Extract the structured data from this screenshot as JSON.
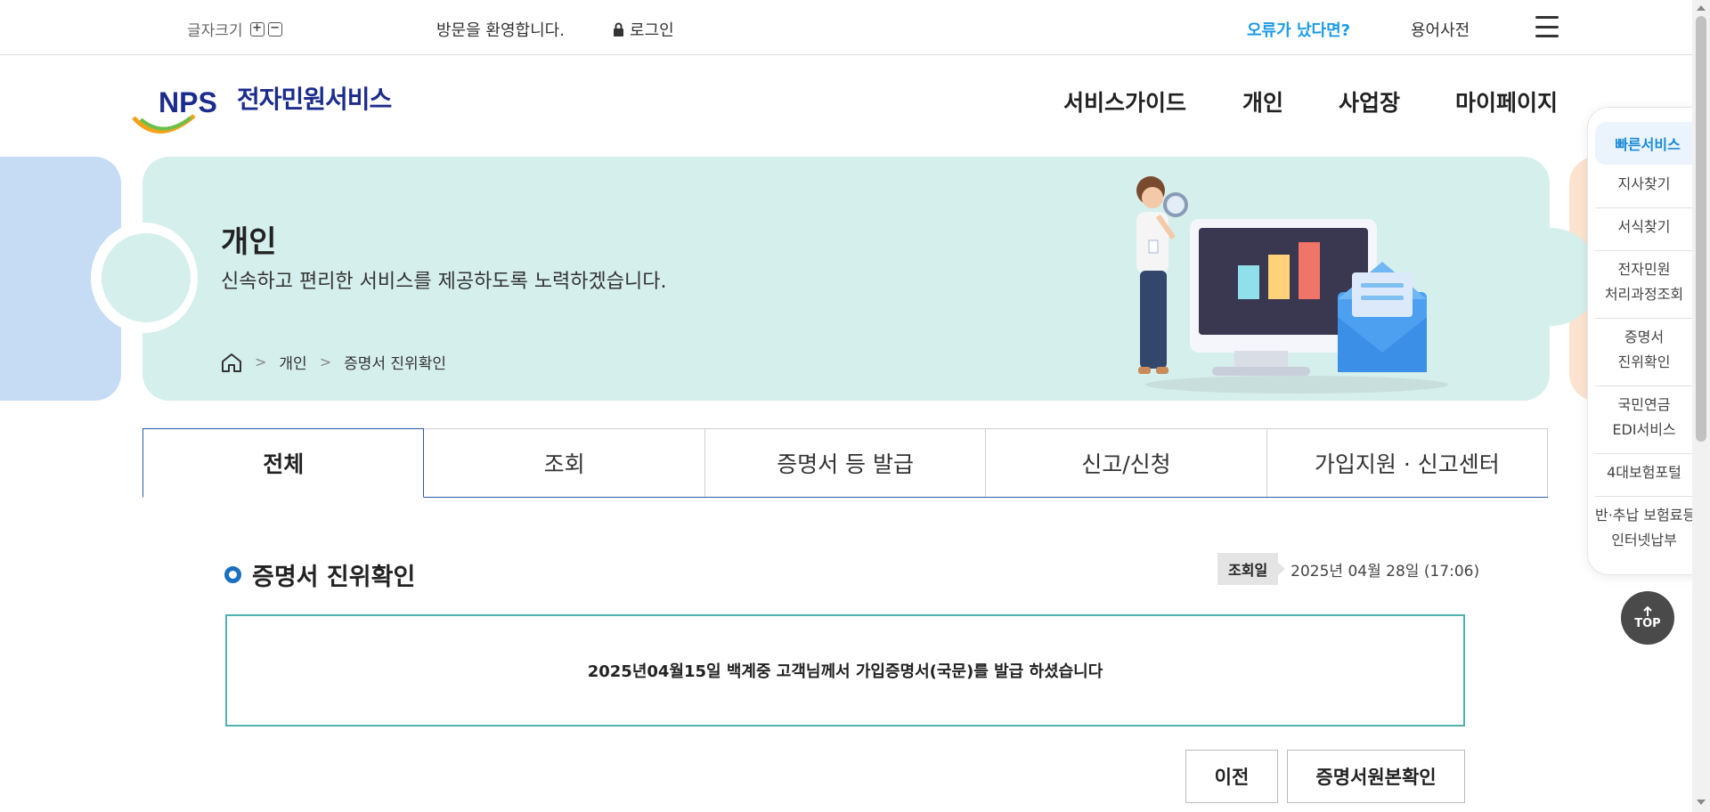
{
  "utility": {
    "font_size_label": "글자크기",
    "font_plus": "+",
    "font_minus": "−",
    "welcome": "방문을 환영합니다.",
    "login": "로그인",
    "error_link": "오류가 났다면?",
    "glossary": "용어사전"
  },
  "header": {
    "logo_npc": "NPS",
    "logo_title": "전자민원서비스",
    "nav": [
      "서비스가이드",
      "개인",
      "사업장",
      "마이페이지"
    ]
  },
  "banner": {
    "title": "개인",
    "subtitle": "신속하고 편리한 서비스를 제공하도록 노력하겠습니다.",
    "breadcrumb": [
      "개인",
      "증명서 진위확인"
    ],
    "breadcrumb_sep": ">"
  },
  "tabs": [
    {
      "label": "전체",
      "active": true
    },
    {
      "label": "조회",
      "active": false
    },
    {
      "label": "증명서 등 발급",
      "active": false
    },
    {
      "label": "신고/신청",
      "active": false
    },
    {
      "label": "가입지원 · 신고센터",
      "active": false
    }
  ],
  "content": {
    "section_title": "증명서 진위확인",
    "date_label": "조회일",
    "date_value": "2025년 04월 28일 (17:06)",
    "result_message": "2025년04월15일 백계중 고객님께서 가입증명서(국문)를 발급 하셨습니다",
    "btn_prev": "이전",
    "btn_verify": "증명서원본확인"
  },
  "quick_menu": {
    "title": "빠른서비스",
    "items": [
      {
        "line1": "지사찾기",
        "line2": ""
      },
      {
        "line1": "서식찾기",
        "line2": ""
      },
      {
        "line1": "전자민원",
        "line2": "처리과정조회"
      },
      {
        "line1": "증명서",
        "line2": "진위확인"
      },
      {
        "line1": "국민연금",
        "line2": "EDI서비스"
      },
      {
        "line1": "4대보험포털",
        "line2": ""
      },
      {
        "line1": "반·추납 보험료등",
        "line2": "인터넷납부"
      }
    ],
    "top": "TOP"
  },
  "colors": {
    "accent_blue": "#1a9be6",
    "banner_mint": "#d5efec",
    "brand_navy": "#1c2c8c",
    "result_border": "#4fb3ad"
  }
}
